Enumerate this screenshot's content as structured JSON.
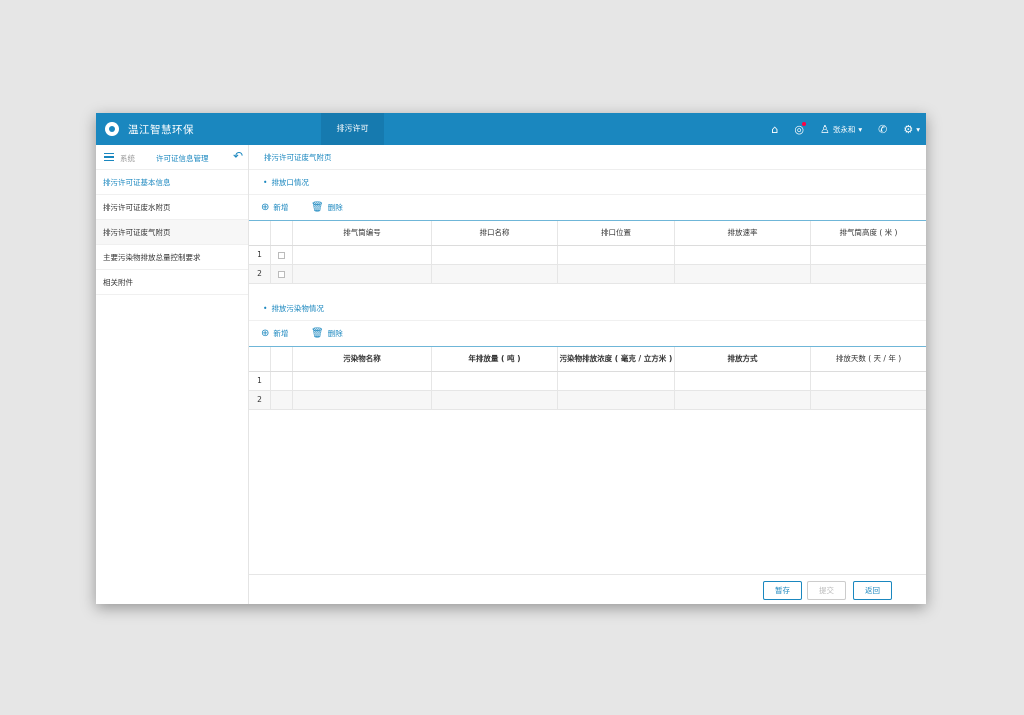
{
  "app": {
    "title": "温江智慧环保",
    "active_tab": "排污许可"
  },
  "topbar": {
    "user_name": "张永和",
    "icons": [
      "home-icon",
      "message-icon",
      "user-icon",
      "phone-icon",
      "gear-icon"
    ],
    "accent": "#1a87bf"
  },
  "sidebar": {
    "system_label": "系统",
    "breadcrumb": "许可证信息管理",
    "items": [
      {
        "label": "排污许可证基本信息"
      },
      {
        "label": "排污许可证废水附页"
      },
      {
        "label": "排污许可证废气附页"
      },
      {
        "label": "主要污染物排放总量控制要求"
      },
      {
        "label": "相关附件"
      }
    ]
  },
  "main": {
    "title": "排污许可证废气附页",
    "section1": {
      "title": "排放口情况",
      "add_label": "新增",
      "delete_label": "删除",
      "columns": [
        "排气筒编号",
        "排口名称",
        "排口位置",
        "排放速率",
        "排气筒高度 ( 米 )"
      ],
      "rows": [
        "1",
        "2"
      ]
    },
    "section2": {
      "title": "排放污染物情况",
      "add_label": "新增",
      "delete_label": "删除",
      "columns": [
        "污染物名称",
        "年排放量 ( 吨 )",
        "污染物排放浓度 ( 毫克 / 立方米 )",
        "排放方式",
        "排放天数 ( 天 / 年 )"
      ],
      "rows": [
        "1",
        "2"
      ]
    }
  },
  "footer": {
    "save_label": "暂存",
    "submit_label": "提交",
    "back_label": "返回"
  }
}
